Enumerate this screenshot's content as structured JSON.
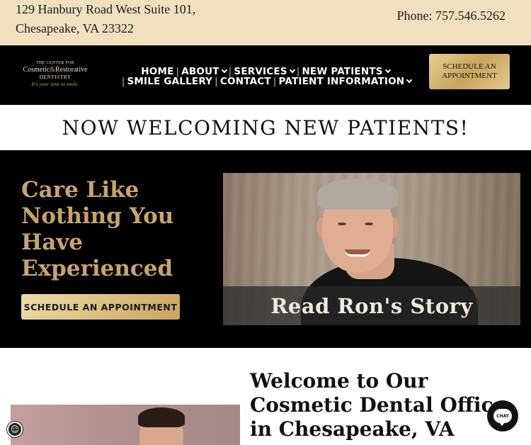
{
  "topbar": {
    "address_line1": "129 Hanbury Road West Suite 101,",
    "address_line2": "Chesapeake, VA 23322",
    "phone": "Phone: 757.546.5262"
  },
  "logo": {
    "line1": "THE CENTER FOR",
    "line2_a": "Cosmetic",
    "line2_amp": "&",
    "line2_b": "Restorative",
    "line3": "DENTISTRY",
    "tagline": "It's your time to smile."
  },
  "nav": {
    "items": [
      {
        "label": "HOME",
        "dropdown": false
      },
      {
        "label": "ABOUT",
        "dropdown": true
      },
      {
        "label": "SERVICES",
        "dropdown": true
      },
      {
        "label": "NEW PATIENTS",
        "dropdown": true
      },
      {
        "label": "SMILE GALLERY",
        "dropdown": false
      },
      {
        "label": "CONTACT",
        "dropdown": false
      },
      {
        "label": "PATIENT INFORMATION",
        "dropdown": true
      }
    ],
    "schedule_label": "SCHEDULE AN APPOINTMENT"
  },
  "banner": {
    "text": "NOW WELCOMING NEW PATIENTS!"
  },
  "hero": {
    "title": "Care Like Nothing You Have Experienced",
    "button_label": "SCHEDULE AN APPOINTMENT",
    "photo_caption": "Read Ron's Story"
  },
  "welcome": {
    "heading": "Welcome to Our Cosmetic Dental Office in Chesapeake, VA"
  },
  "widgets": {
    "chat_label": "CHAT"
  },
  "colors": {
    "topbar_bg": "#f0e0c0",
    "gold_accent": "#c7a468",
    "dark_bg": "#000000"
  }
}
